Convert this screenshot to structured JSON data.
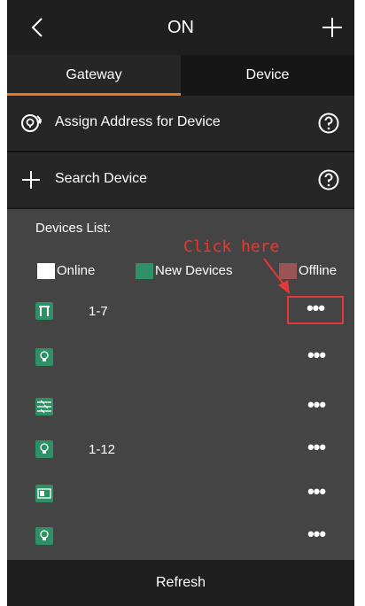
{
  "header": {
    "title": "ON"
  },
  "tabs": {
    "gateway": "Gateway",
    "device": "Device"
  },
  "actions": {
    "assign": "Assign Address for Device",
    "search": "Search Device"
  },
  "devices_list": {
    "title": "Devices List:",
    "annotation": "Click here",
    "legend": [
      {
        "label": "Online",
        "color": "#ffffff"
      },
      {
        "label": "New Devices",
        "color": "#2f8f66"
      },
      {
        "label": "Offline",
        "color": "#9a5454"
      }
    ],
    "items": [
      {
        "icon": "curtain-icon",
        "address": "1-7",
        "more": "•••"
      },
      {
        "icon": "bulb-icon",
        "address": "",
        "more": "•••"
      },
      {
        "icon": "panel-switch-icon",
        "address": "",
        "more": "•••"
      },
      {
        "icon": "bulb-icon",
        "address": "1-12",
        "more": "•••"
      },
      {
        "icon": "display-icon",
        "address": "",
        "more": "•••"
      },
      {
        "icon": "bulb-icon",
        "address": "",
        "more": "•••"
      }
    ]
  },
  "footer": {
    "refresh": "Refresh"
  },
  "colors": {
    "accent": "#e87722",
    "highlight": "#e53935",
    "device_green": "#2f8f66"
  }
}
